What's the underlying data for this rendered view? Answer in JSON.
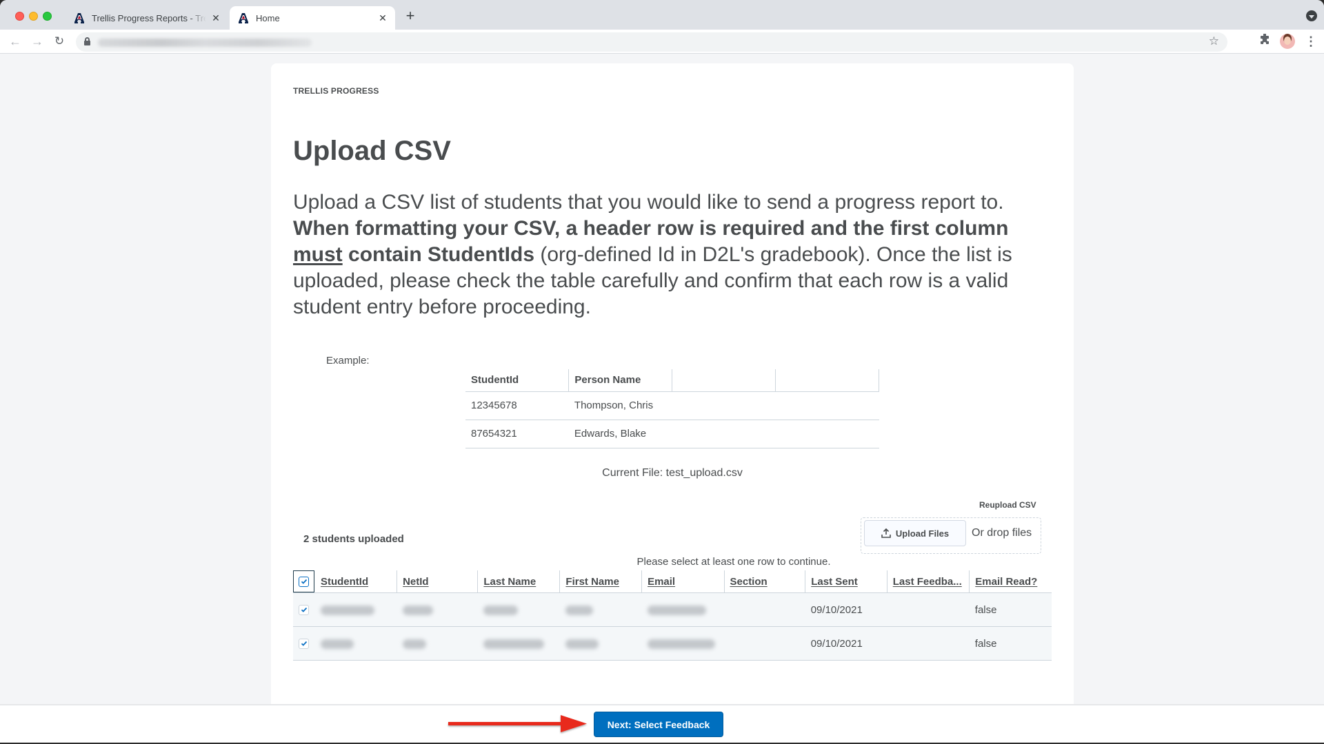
{
  "browser": {
    "tabs": [
      {
        "title": "Trellis Progress Reports - Trellis",
        "active": false
      },
      {
        "title": "Home",
        "active": true
      }
    ],
    "new_tab_label": "+",
    "close_glyph": "✕",
    "icons": {
      "back": "←",
      "forward": "→",
      "reload": "↻",
      "star": "☆",
      "extensions": "puzzle-icon",
      "menu": "⋮"
    }
  },
  "page": {
    "brand": "TRELLIS PROGRESS",
    "title": "Upload CSV",
    "intro": {
      "part1": "Upload a CSV list of students that you would like to send a progress report to. ",
      "bold1": "When formatting your CSV, a header row is required and the first column ",
      "underline": "must",
      "bold2": " contain StudentIds",
      "part2": " (org-defined Id in D2L's gradebook). Once the list is uploaded, please check the table carefully and confirm that each row is a valid student entry before proceeding."
    },
    "example": {
      "label": "Example:",
      "headers": [
        "StudentId",
        "Person Name",
        "",
        ""
      ],
      "rows": [
        [
          "12345678",
          "Thompson, Chris",
          "",
          ""
        ],
        [
          "87654321",
          "Edwards, Blake",
          "",
          ""
        ]
      ]
    },
    "current_file": "Current File: test_upload.csv",
    "reupload": {
      "label": "Reupload CSV",
      "button": "Upload Files",
      "drop_text": "Or drop files"
    },
    "students_count": "2 students uploaded",
    "select_message": "Please select at least one row to continue.",
    "table": {
      "select_all_checked": true,
      "headers": [
        "StudentId",
        "NetId",
        "Last Name",
        "First Name",
        "Email",
        "Section",
        "Last Sent",
        "Last Feedba...",
        "Email Read?"
      ],
      "rows": [
        {
          "checked": true,
          "studentId": "[redacted]",
          "netId": "[redacted]",
          "lastName": "[redacted]",
          "firstName": "[redacted]",
          "email": "[redacted]",
          "section": "",
          "lastSent": "09/10/2021",
          "lastFeedback": "",
          "emailRead": "false"
        },
        {
          "checked": true,
          "studentId": "[redacted]",
          "netId": "[redacted]",
          "lastName": "[redacted]",
          "firstName": "[redacted]",
          "email": "[redacted]",
          "section": "",
          "lastSent": "09/10/2021",
          "lastFeedback": "",
          "emailRead": "false"
        }
      ]
    },
    "next_button": "Next: Select Feedback"
  },
  "colors": {
    "primary_button": "#006fbf",
    "annotation_arrow": "#e8291c",
    "text": "#494c4e"
  }
}
